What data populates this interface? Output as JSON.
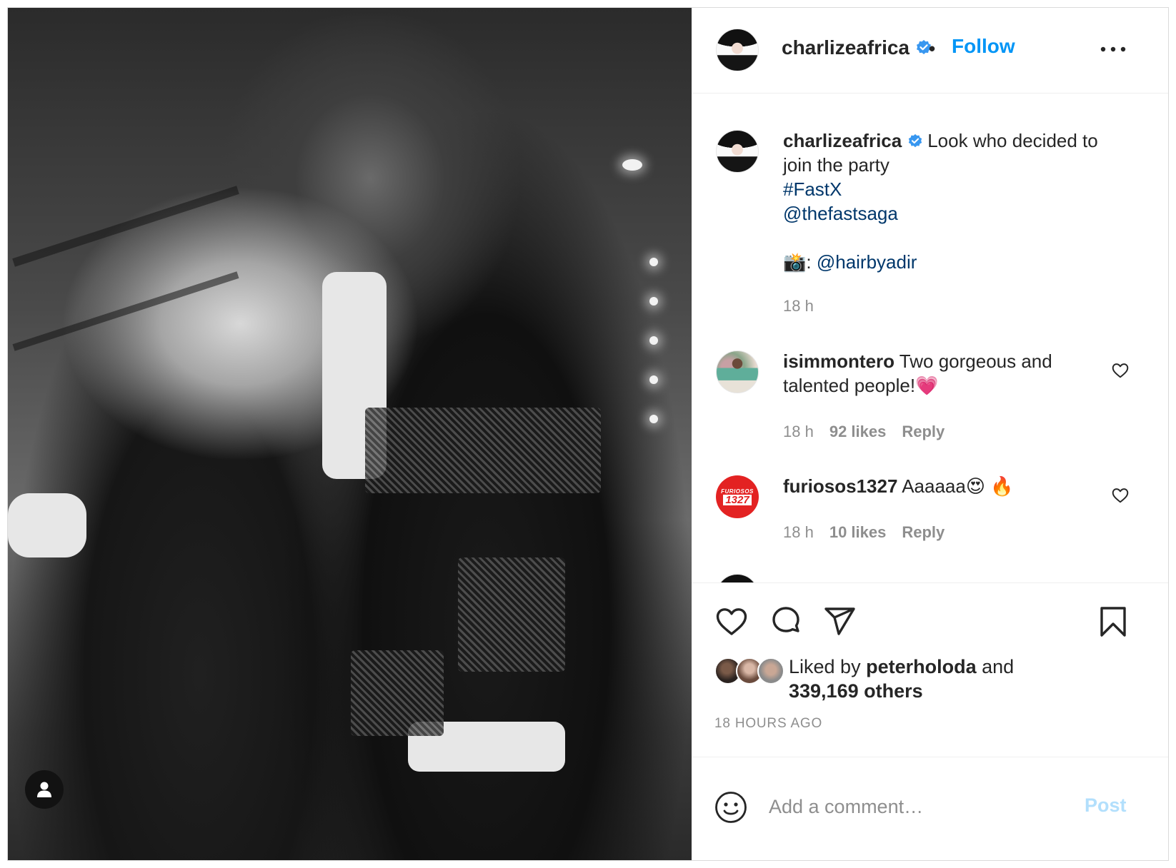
{
  "post": {
    "username": "charlizeafrica",
    "verified_icon": "verified-badge-icon",
    "separator": "•",
    "follow_label": "Follow",
    "more_icon": "more-options-icon"
  },
  "caption": {
    "username": "charlizeafrica",
    "text_line1": "Look who decided to",
    "text_line2": "join the party",
    "hashtag": "#FastX",
    "mention1": "@thefastsaga",
    "camera_emoji": "📸",
    "colon": ":",
    "mention2": "@hairbyadir",
    "time": "18 h"
  },
  "comments": [
    {
      "username": "isimmontero",
      "text_line1": "Two gorgeous and",
      "text_line2": "talented people!",
      "emoji": "💗",
      "time": "18 h",
      "likes": "92 likes",
      "reply_label": "Reply"
    },
    {
      "username": "furiosos1327",
      "text": "Aaaaaa",
      "emoji": "😍 🔥",
      "avatar_text_top": "FURIOSOS",
      "avatar_text_bottom": "1327",
      "time": "18 h",
      "likes": "10 likes",
      "reply_label": "Reply"
    }
  ],
  "likes": {
    "liked_by_prefix": "Liked by",
    "liked_by_user": "peterholoda",
    "and_label": "and",
    "others_count": "339,169 others"
  },
  "timestamp": "18 HOURS AGO",
  "add_comment": {
    "placeholder": "Add a comment…",
    "post_label": "Post"
  },
  "colors": {
    "accent": "#0095f6",
    "link": "#00376b",
    "muted": "#8e8e8e",
    "post_disabled": "#b2dffc"
  }
}
